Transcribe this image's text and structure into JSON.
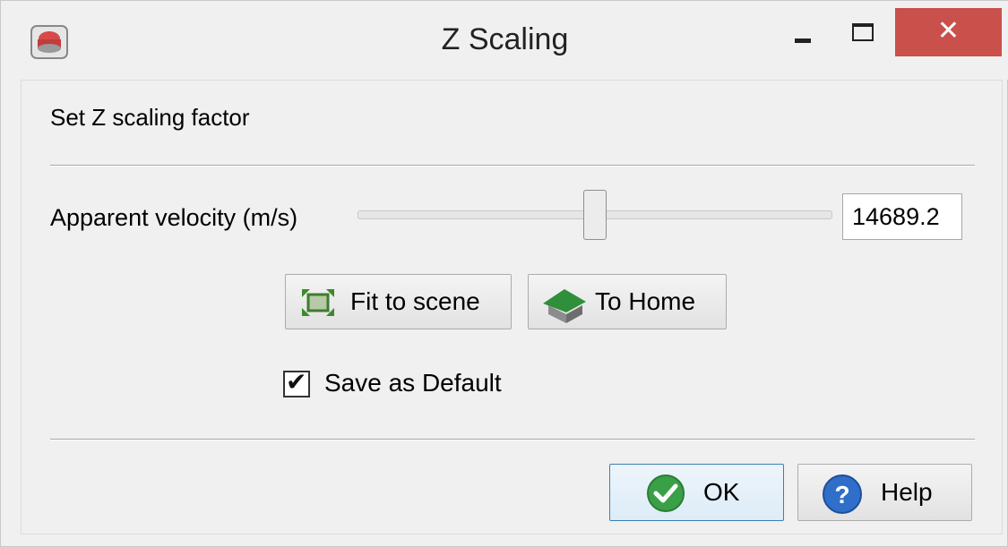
{
  "window": {
    "title": "Z Scaling",
    "close_glyph": "✕"
  },
  "dialog": {
    "heading": "Set Z scaling factor",
    "velocity_label": "Apparent velocity (m/s)",
    "velocity_value": "14689.2",
    "slider_level": 0.5,
    "fit_button_label": "Fit to scene",
    "home_button_label": "To Home",
    "checkbox_label": "Save as Default",
    "checkbox_checked": true,
    "ok_label": "OK",
    "help_label": "Help"
  },
  "icons": {
    "app": "app-icon",
    "fit": "fit-to-scene-icon",
    "home": "home-icon",
    "ok": "checkmark-circle-icon",
    "help": "question-circle-icon"
  },
  "colors": {
    "close_button": "#c9504b",
    "ok_border": "#3c7fb1"
  }
}
